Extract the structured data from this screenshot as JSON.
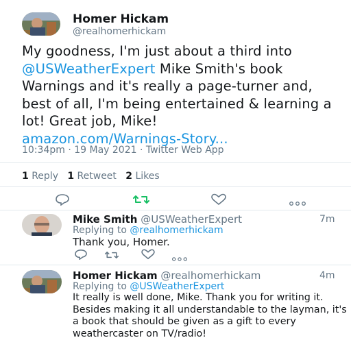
{
  "main_tweet": {
    "author_name": "Homer Hickam",
    "author_handle": "@realhomerhickam",
    "text_before": "My goodness, I'm just about a third into ",
    "mention": "@USWeatherExpert",
    "text_after": " Mike Smith's book Warnings and it's really a page-turner and, best of all, I'm being entertained & learning a lot! Great job, Mike!",
    "link": "amazon.com/Warnings-Story...",
    "meta": "10:34pm · 19 May 2021 · Twitter Web App",
    "stats": {
      "replies_count": "1",
      "replies_label": "Reply",
      "retweets_count": "1",
      "retweets_label": "Retweet",
      "likes_count": "2",
      "likes_label": "Likes"
    }
  },
  "replies": [
    {
      "author_name": "Mike Smith",
      "author_handle": "@USWeatherExpert",
      "time": "7m",
      "replying_to_label": "Replying to",
      "replying_to_handle": "@realhomerhickam",
      "text": "Thank you, Homer."
    },
    {
      "author_name": "Homer Hickam",
      "author_handle": "@realhomerhickam",
      "time": "4m",
      "replying_to_label": "Replying to",
      "replying_to_handle": "@USWeatherExpert",
      "text": "It really is well done, Mike. Thank you for writing it. Besides making it all understandable to the layman, it's a book that should be given as a gift to every weathercaster on TV/radio!"
    }
  ],
  "colors": {
    "link": "#1b95e0",
    "muted": "#657786",
    "retweet_active": "#17bf63",
    "divider": "#e1e8ed"
  },
  "icons": [
    "reply-icon",
    "retweet-icon",
    "like-icon",
    "more-icon"
  ]
}
